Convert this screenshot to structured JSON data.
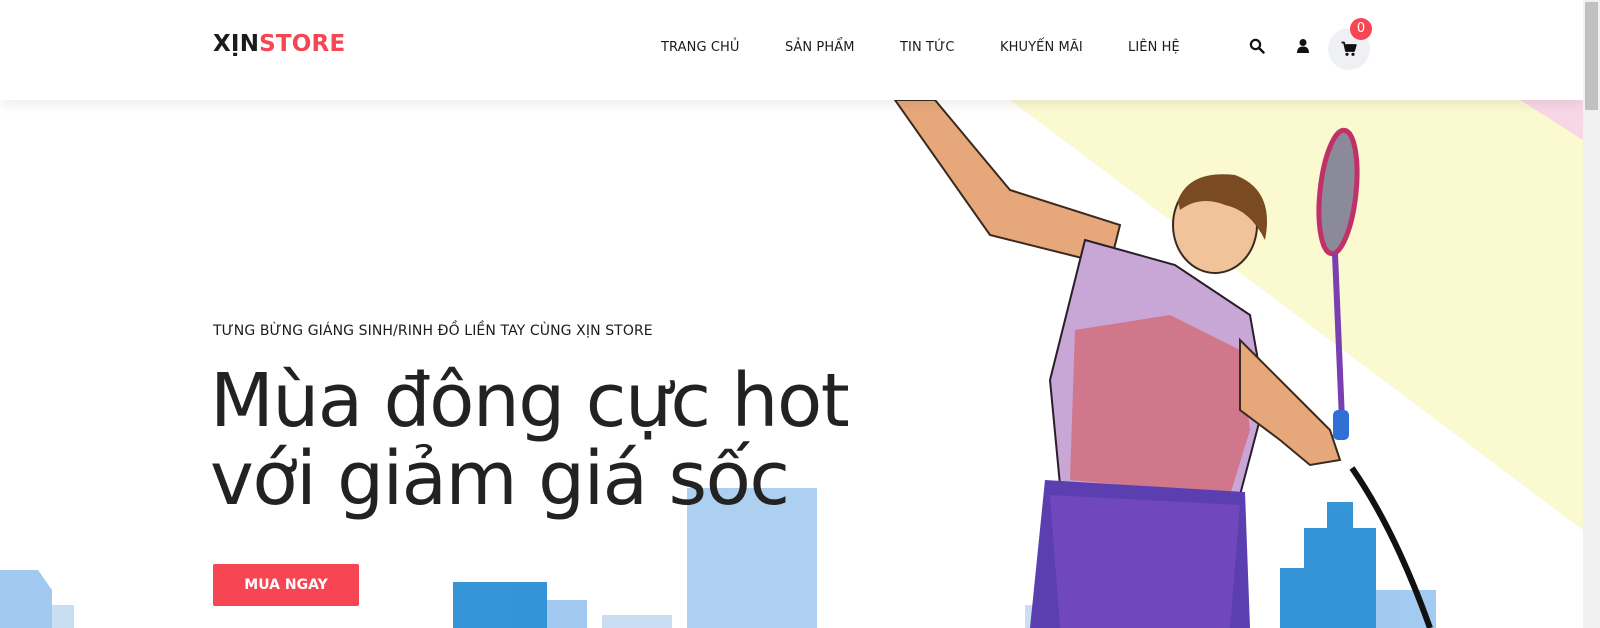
{
  "brand": {
    "part1": "XỊN",
    "part2": "STORE",
    "accent_color": "#f64553"
  },
  "nav": {
    "items": [
      {
        "label": "TRANG CHỦ"
      },
      {
        "label": "SẢN PHẨM"
      },
      {
        "label": "TIN TỨC"
      },
      {
        "label": "KHUYẾN MÃI"
      },
      {
        "label": "LIÊN HỆ"
      }
    ]
  },
  "header_icons": {
    "search": "search-icon",
    "user": "user-icon",
    "cart": "cart-icon"
  },
  "cart": {
    "count": "0"
  },
  "hero": {
    "subtitle": "TƯNG BỪNG GIÁNG SINH/RINH ĐỒ LIỀN TAY CÙNG XỊN STORE",
    "title_line1": "Mùa đông cực hot",
    "title_line2": "với giảm giá sốc",
    "cta_label": "MUA NGAY"
  }
}
